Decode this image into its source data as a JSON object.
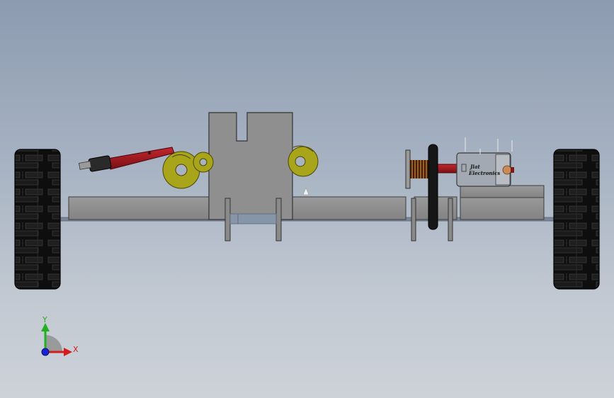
{
  "model": {
    "motor": {
      "label_line1": "Jlat",
      "label_line2": "Electronics"
    }
  },
  "triad": {
    "y_label": "Y",
    "x_label": "X"
  },
  "colors": {
    "background_top": "#8c9bb0",
    "background_bottom": "#cdd2d8",
    "chassis_gray": "#8e8e8e",
    "tire_black": "#111111",
    "linkage_red": "#a01a1a",
    "cam_yellow": "#a9a51a",
    "axis_x": "#d41c1c",
    "axis_y": "#22b022",
    "axis_z": "#1a22d4"
  },
  "icons": {
    "view_triad": "coordinate-triad-icon"
  }
}
